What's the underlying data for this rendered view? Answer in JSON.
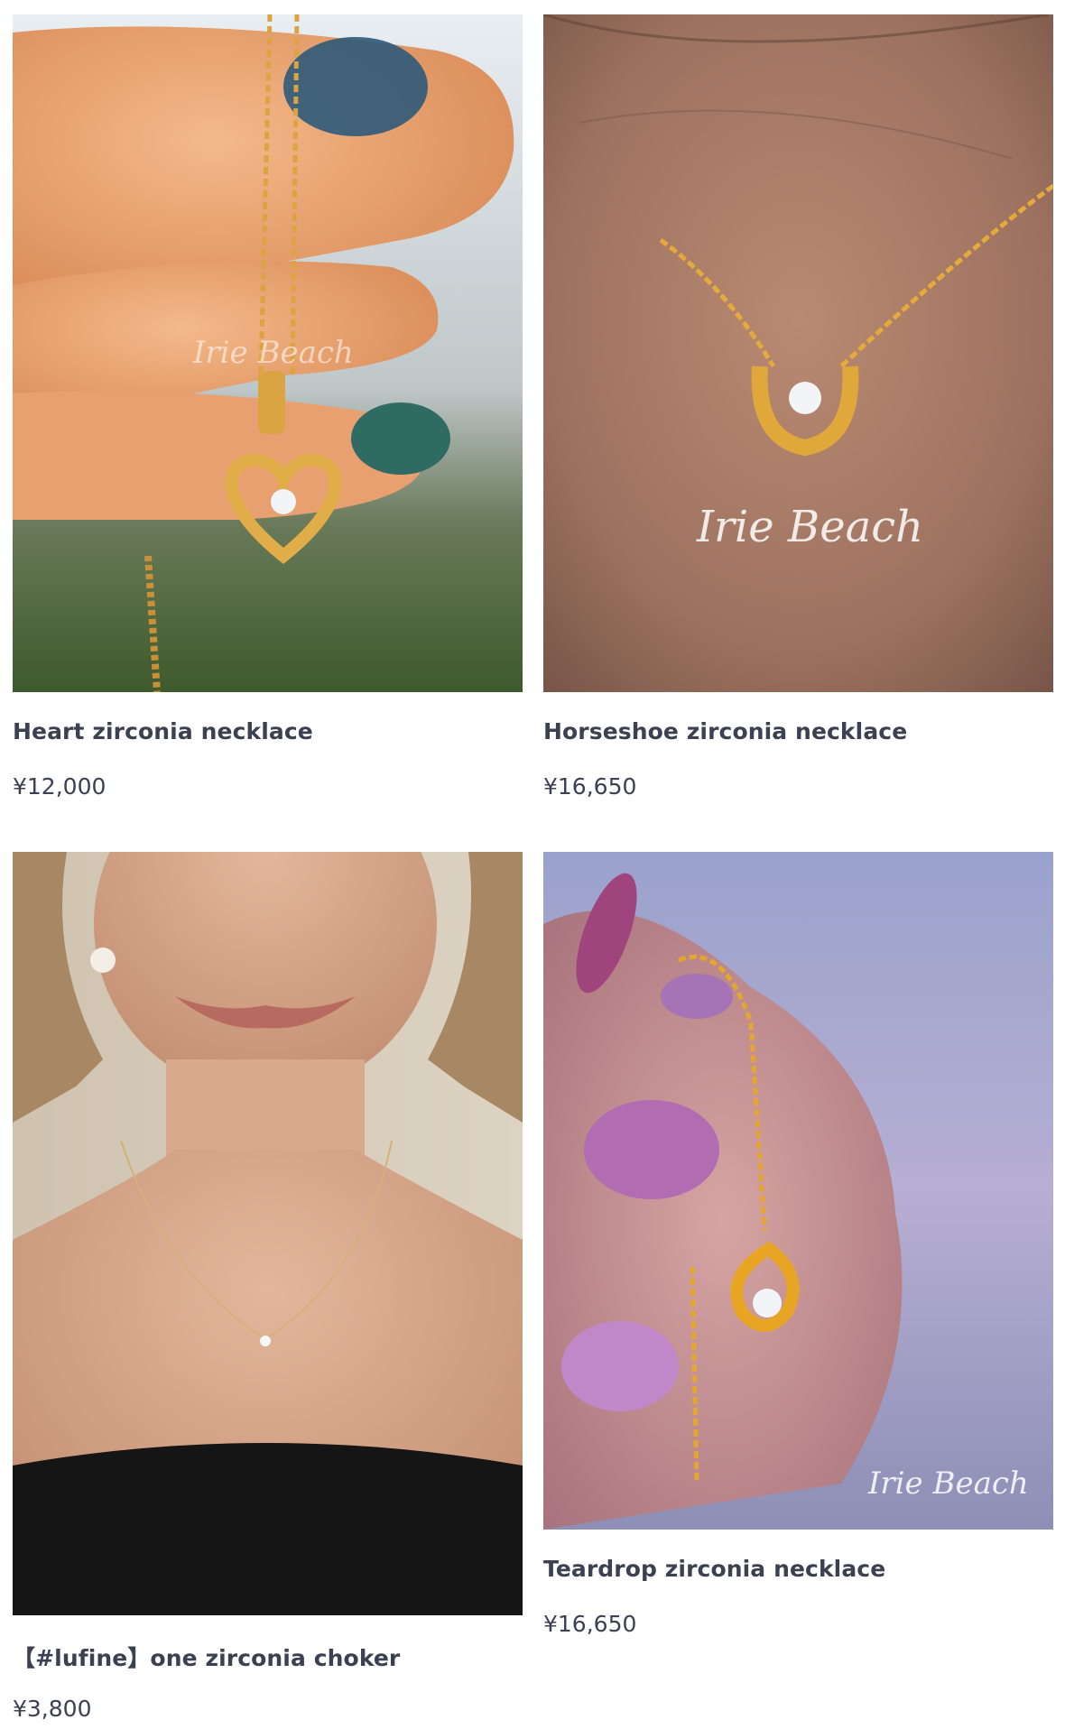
{
  "products": [
    {
      "title": "Heart zirconia necklace",
      "price": "¥12,000",
      "watermark": "Irie Beach"
    },
    {
      "title": "Horseshoe zirconia necklace",
      "price": "¥16,650",
      "watermark": "Irie Beach"
    },
    {
      "title": "【#lufine】one zirconia choker",
      "price": "¥3,800",
      "watermark": ""
    },
    {
      "title": "Teardrop zirconia necklace",
      "price": "¥16,650",
      "watermark": "Irie Beach"
    }
  ],
  "colors": {
    "text": "#3b4150",
    "background": "#ffffff",
    "gold": "#d9a441"
  }
}
